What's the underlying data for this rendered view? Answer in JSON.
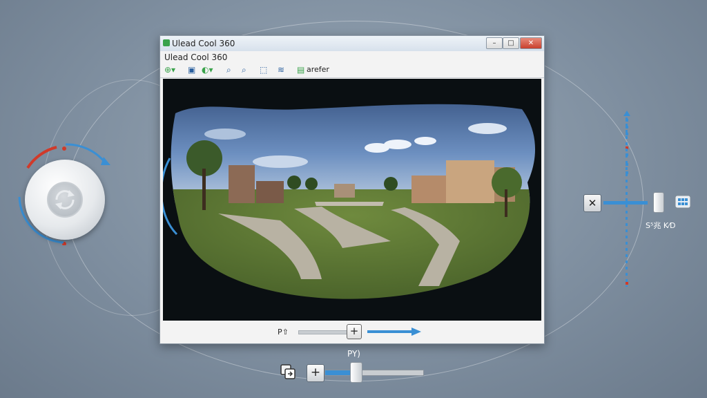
{
  "window": {
    "title": "Ulead Cool 360",
    "subtitle": "Ulead Cool 360",
    "minimize_glyph": "–",
    "maximize_glyph": "□",
    "close_glyph": "✕"
  },
  "toolbar": {
    "label": "arefer",
    "icons": [
      "add-icon",
      "image-icon",
      "palette-icon",
      "zoom-in-icon",
      "zoom-out-icon",
      "select-icon",
      "settings-icon",
      "document-icon"
    ]
  },
  "pan_bar": {
    "label": "P⇧",
    "plus_glyph": "+"
  },
  "right_panel": {
    "close_glyph": "✕",
    "label": "S⁵兆 K⁄D"
  },
  "bottom_controls": {
    "label": "PY)",
    "plus_glyph": "+",
    "zoom_fraction": 0.3
  },
  "colors": {
    "accent": "#3a8fd4",
    "marker_red": "#d03a2a",
    "background": "#8596a6"
  }
}
